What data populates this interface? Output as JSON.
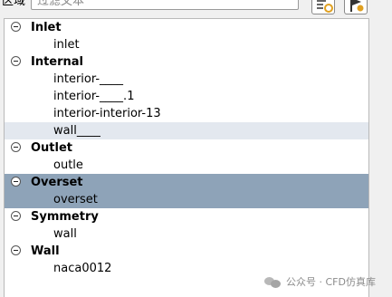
{
  "filter": {
    "region_label": "区域",
    "placeholder": "过滤文本"
  },
  "toolbar": {
    "buttons": [
      "filter-options-icon",
      "flag-icon"
    ]
  },
  "tree": [
    {
      "label": "Inlet",
      "expanded": true,
      "children": [
        {
          "label": "inlet"
        }
      ]
    },
    {
      "label": "Internal",
      "expanded": true,
      "children": [
        {
          "label": "interior-____"
        },
        {
          "label": "interior-____.1"
        },
        {
          "label": "interior-interior-13"
        },
        {
          "label": "wall____",
          "state": "hover"
        }
      ]
    },
    {
      "label": "Outlet",
      "expanded": true,
      "children": [
        {
          "label": "outle"
        }
      ]
    },
    {
      "label": "Overset",
      "expanded": true,
      "selected": true,
      "children": [
        {
          "label": "overset",
          "state": "selected"
        }
      ]
    },
    {
      "label": "Symmetry",
      "expanded": true,
      "children": [
        {
          "label": "wall"
        }
      ]
    },
    {
      "label": "Wall",
      "expanded": true,
      "children": [
        {
          "label": "naca0012"
        }
      ]
    }
  ],
  "watermark": {
    "text": "公众号 · CFD仿真库"
  },
  "colors": {
    "selected_bg": "#8ea3b8",
    "hover_bg": "#e3e8ef"
  }
}
